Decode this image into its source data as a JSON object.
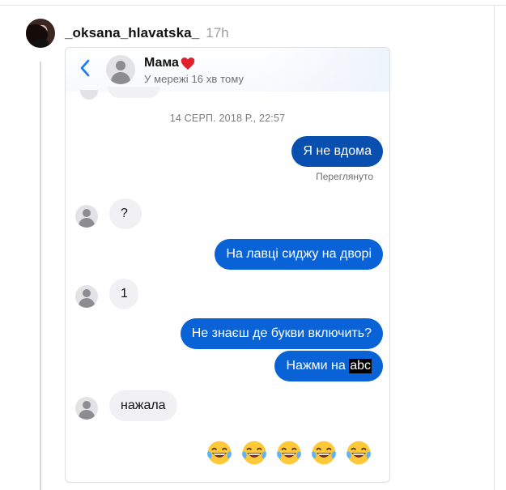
{
  "post": {
    "username": "_oksana_hlavatska_",
    "time": "17h"
  },
  "chat": {
    "contact_name": "Мама",
    "contact_status": "У мережі 16 хв тому",
    "date_separator": "14 СЕРП. 2018 Р., 22:57",
    "seen_label": "Переглянуто",
    "messages": [
      {
        "dir": "out",
        "text": "Я не вдома"
      },
      {
        "dir": "in",
        "text": "?"
      },
      {
        "dir": "out",
        "text": "На лавці сиджу на дворі"
      },
      {
        "dir": "in",
        "text": "1"
      },
      {
        "dir": "out",
        "text": "Не знаєш де букви включить?"
      },
      {
        "dir": "out",
        "text_prefix": "Нажми на ",
        "text_highlight": "abc"
      },
      {
        "dir": "in",
        "text": "нажала"
      }
    ],
    "final_reaction": {
      "emoji": "face-with-tears-of-joy",
      "count": 5
    }
  },
  "colors": {
    "outgoing_bubble": "#0a63d6",
    "incoming_bubble": "#f1f1f3",
    "back_arrow": "#1877f2",
    "heart": "#e2222b"
  }
}
